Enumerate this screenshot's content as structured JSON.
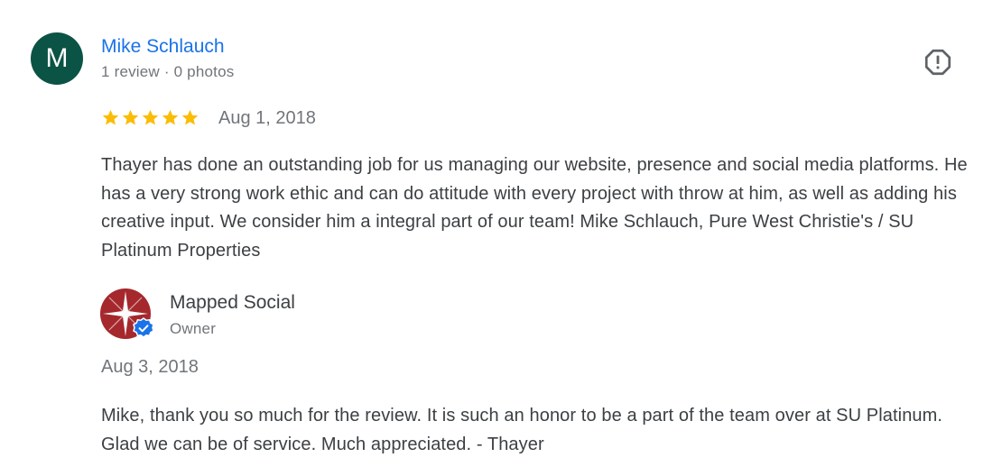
{
  "review": {
    "avatar_letter": "M",
    "avatar_color": "#0b5345",
    "reviewer_name": "Mike Schlauch",
    "reviewer_meta": "1 review · 0 photos",
    "rating": 5,
    "max_rating": 5,
    "star_color": "#fbbc04",
    "date": "Aug 1, 2018",
    "text": "Thayer has done an outstanding job for us managing our website, presence and social media platforms. He has a very strong work ethic and can do attitude with every project with throw at him, as well as adding his creative input. We consider him a integral part of our team! Mike Schlauch, Pure West Christie's / SU Platinum Properties",
    "report_icon": "report-flag-icon"
  },
  "owner_reply": {
    "name": "Mapped Social",
    "role": "Owner",
    "logo_icon": "compass-logo-icon",
    "verified_icon": "verified-badge-icon",
    "logo_color": "#a5282d",
    "verified_color": "#1a73e8",
    "date": "Aug 3, 2018",
    "text": "Mike, thank you so much for the review. It is such an honor to be a part of the team over at SU Platinum. Glad we can be of service. Much appreciated. - Thayer"
  },
  "colors": {
    "link": "#1a73e8",
    "text": "#3c4043",
    "muted": "#70757a"
  }
}
